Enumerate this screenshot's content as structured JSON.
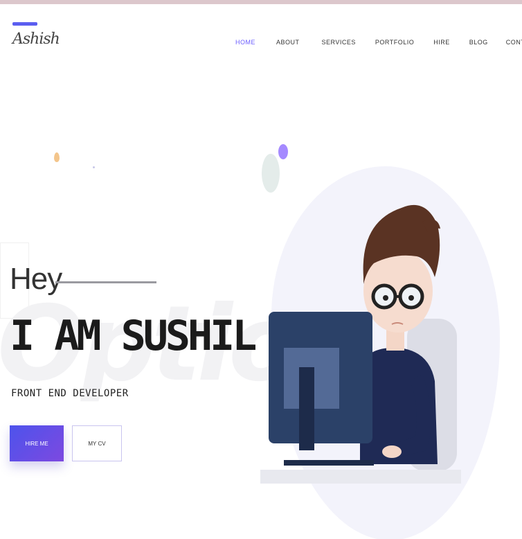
{
  "brand": {
    "name": "Ashish",
    "tagline": ""
  },
  "nav": {
    "items": [
      {
        "label": "Home",
        "active": true
      },
      {
        "label": "About",
        "active": false
      },
      {
        "label": "Services",
        "active": false
      },
      {
        "label": "Portfolio",
        "active": false
      },
      {
        "label": "Hire",
        "active": false
      },
      {
        "label": "Blog",
        "active": false
      },
      {
        "label": "Contact",
        "active": false
      }
    ]
  },
  "hero": {
    "greeting": "Hey",
    "headline": "I AM SUSHIL",
    "role": "FRONT END DEVELOPER",
    "background_word": "Option",
    "primary_button": "HIRE ME",
    "secondary_button": "MY CV"
  },
  "colors": {
    "accent": "#5b5ef0",
    "accent_active": "#6a5cff",
    "topbar": "#dcc7cc"
  },
  "illustration": {
    "icon": "developer-at-computer-illustration"
  }
}
